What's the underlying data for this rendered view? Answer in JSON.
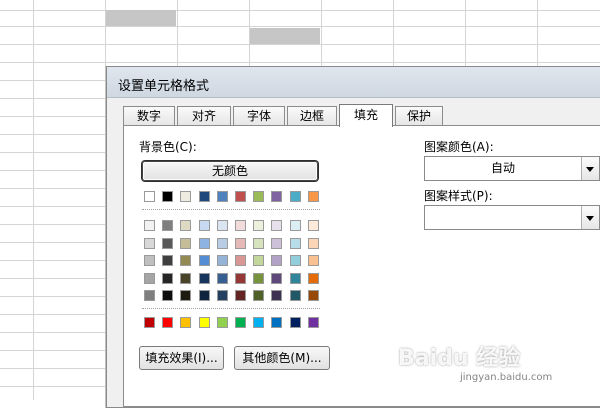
{
  "dialog": {
    "title": "设置单元格格式",
    "tabs": [
      {
        "label": "数字"
      },
      {
        "label": "对齐"
      },
      {
        "label": "字体"
      },
      {
        "label": "边框"
      },
      {
        "label": "填充",
        "active": true
      },
      {
        "label": "保护"
      }
    ],
    "background": {
      "label": "背景色(C):",
      "no_color_button": "无颜色"
    },
    "pattern_color": {
      "label": "图案颜色(A):",
      "value": "自动"
    },
    "pattern_style": {
      "label": "图案样式(P):",
      "value": ""
    },
    "buttons": {
      "fill_effects": "填充效果(I)...",
      "more_colors": "其他颜色(M)..."
    },
    "palette": {
      "base": [
        "#ffffff",
        "#000000",
        "#eeece1",
        "#1f497d",
        "#4f81bd",
        "#c0504d",
        "#9bbb59",
        "#8064a2",
        "#4bacc6",
        "#f79646"
      ],
      "shades": [
        [
          "#f2f2f2",
          "#7f7f7f",
          "#ddd9c3",
          "#c6d9f0",
          "#dbe5f1",
          "#f2dcdb",
          "#ebf1dd",
          "#e5e0ec",
          "#dbeef3",
          "#fdeada"
        ],
        [
          "#d8d8d8",
          "#595959",
          "#c4bd97",
          "#8db3e2",
          "#b8cce4",
          "#e5b9b7",
          "#d7e3bc",
          "#ccc1d9",
          "#b7dde8",
          "#fbd5b5"
        ],
        [
          "#bfbfbf",
          "#3f3f3f",
          "#938953",
          "#548dd4",
          "#95b3d7",
          "#d99694",
          "#c3d69b",
          "#b2a2c7",
          "#92cddc",
          "#fac08f"
        ],
        [
          "#a5a5a5",
          "#262626",
          "#494429",
          "#17365d",
          "#366092",
          "#953734",
          "#76923c",
          "#5f497a",
          "#31859b",
          "#e36c09"
        ],
        [
          "#7f7f7f",
          "#0c0c0c",
          "#1d1b10",
          "#0f243e",
          "#244061",
          "#632423",
          "#4f6128",
          "#3f3151",
          "#205867",
          "#974806"
        ]
      ],
      "standard": [
        "#c00000",
        "#ff0000",
        "#ffc000",
        "#ffff00",
        "#92d050",
        "#00b050",
        "#00b0f0",
        "#0070c0",
        "#002060",
        "#7030a0"
      ]
    }
  },
  "watermark": {
    "brand": "Baidu 经验",
    "url": "jingyan.baidu.com"
  }
}
